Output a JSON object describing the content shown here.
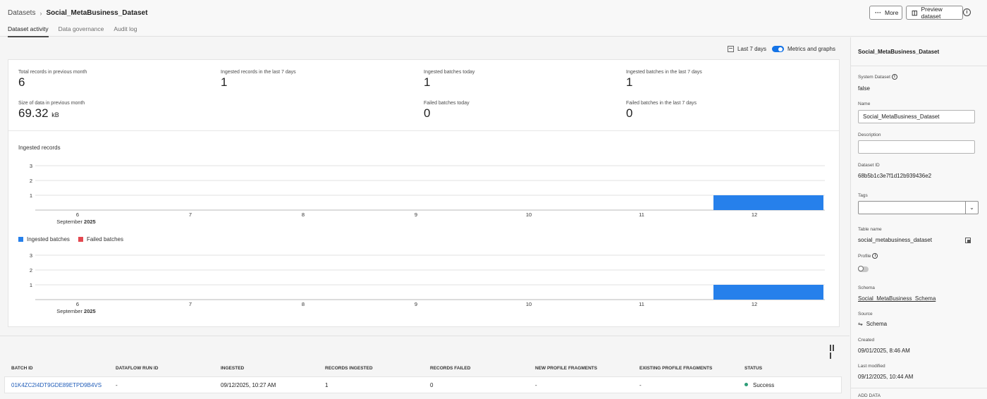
{
  "header": {
    "breadcrumb_root": "Datasets",
    "breadcrumb_current": "Social_MetaBusiness_Dataset",
    "more_label": "More",
    "preview_label": "Preview dataset",
    "tabs": [
      {
        "label": "Dataset activity"
      },
      {
        "label": "Data governance"
      },
      {
        "label": "Audit log"
      }
    ]
  },
  "controls": {
    "range_label": "Last 7 days",
    "metrics_label": "Metrics and graphs"
  },
  "metrics": {
    "total_records_label": "Total records in previous month",
    "total_records_value": "6",
    "ingested_records_label": "Ingested records in the last 7 days",
    "ingested_records_value": "1",
    "batches_today_label": "Ingested batches today",
    "batches_today_value": "1",
    "batches_7d_label": "Ingested batches in the last 7 days",
    "batches_7d_value": "1",
    "size_label": "Size of data in previous month",
    "size_value": "69.32",
    "size_unit": "kB",
    "failed_today_label": "Failed batches today",
    "failed_today_value": "0",
    "failed_7d_label": "Failed batches in the last 7 days",
    "failed_7d_value": "0"
  },
  "chart_data": [
    {
      "type": "bar",
      "title": "Ingested records",
      "categories": [
        "6",
        "7",
        "8",
        "9",
        "10",
        "11",
        "12"
      ],
      "x_sublabel": "September 2025",
      "series": [
        {
          "name": "Ingested records",
          "values": [
            0,
            0,
            0,
            0,
            0,
            0,
            1
          ]
        }
      ],
      "yticks": [
        1,
        2,
        3
      ],
      "ylim": [
        0,
        3
      ],
      "color": "#2680eb"
    },
    {
      "type": "bar",
      "title": "",
      "categories": [
        "6",
        "7",
        "8",
        "9",
        "10",
        "11",
        "12"
      ],
      "x_sublabel": "September 2025",
      "series": [
        {
          "name": "Ingested batches",
          "values": [
            0,
            0,
            0,
            0,
            0,
            0,
            1
          ],
          "color": "#2680eb"
        },
        {
          "name": "Failed batches",
          "values": [
            0,
            0,
            0,
            0,
            0,
            0,
            0
          ],
          "color": "#e34850"
        }
      ],
      "yticks": [
        1,
        2,
        3
      ],
      "ylim": [
        0,
        3
      ]
    }
  ],
  "table": {
    "headers": [
      "BATCH ID",
      "DATAFLOW RUN ID",
      "INGESTED",
      "RECORDS INGESTED",
      "RECORDS FAILED",
      "NEW PROFILE FRAGMENTS",
      "EXISTING PROFILE FRAGMENTS",
      "STATUS"
    ],
    "rows": [
      {
        "batch_id": "01K4ZC2I4DT9GDE89ETPD9B4VS",
        "dataflow_run_id": "-",
        "ingested": "09/12/2025, 10:27 AM",
        "records_ingested": "1",
        "records_failed": "0",
        "new_fragments": "-",
        "existing_fragments": "-",
        "status": "Success"
      }
    ]
  },
  "panel": {
    "title": "Social_MetaBusiness_Dataset",
    "system_dataset_label": "System Dataset",
    "system_dataset_value": "false",
    "name_label": "Name",
    "name_value": "Social_MetaBusiness_Dataset",
    "description_label": "Description",
    "description_value": "",
    "dataset_id_label": "Dataset ID",
    "dataset_id_value": "68b5b1c3e7f1d12b939436e2",
    "tags_label": "Tags",
    "table_name_label": "Table name",
    "table_name_value": "social_metabusiness_dataset",
    "profile_label": "Profile",
    "schema_label": "Schema",
    "schema_value": "Social_MetaBusiness_Schema",
    "source_label": "Source",
    "source_value": "Schema",
    "created_label": "Created",
    "created_value": "09/01/2025, 8:46 AM",
    "modified_label": "Last modified",
    "modified_value": "09/12/2025, 10:44 AM",
    "add_data_label": "ADD DATA"
  }
}
